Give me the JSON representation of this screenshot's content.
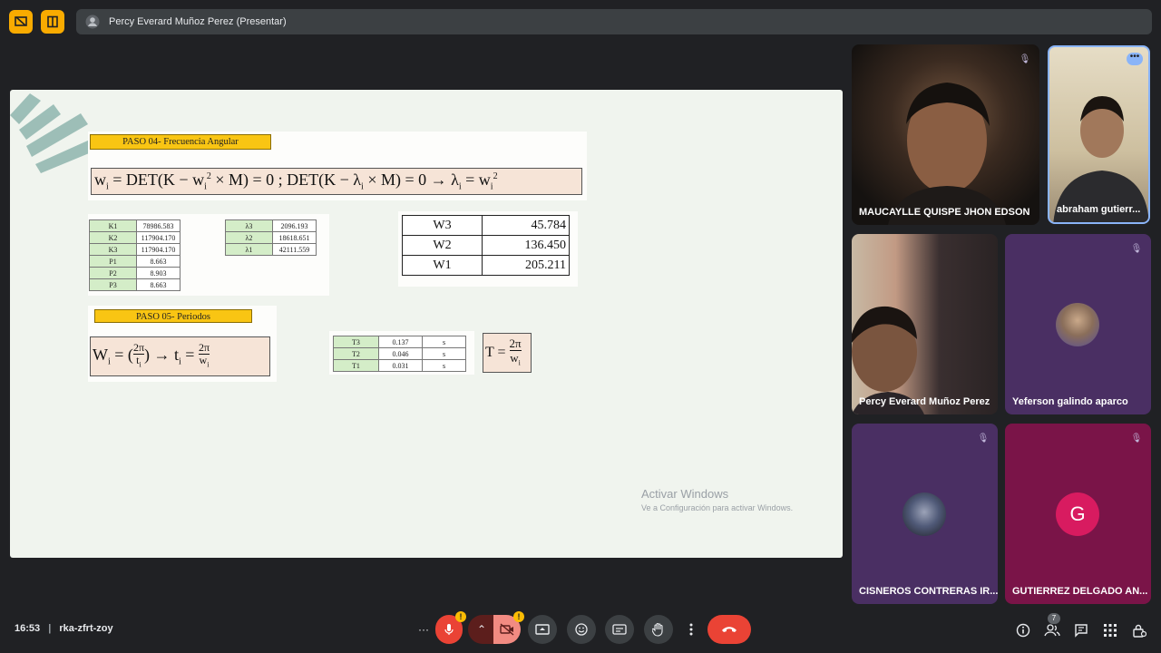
{
  "presenter_banner": "Percy Everard Muñoz Perez (Presentar)",
  "slide": {
    "step4_title": "PASO 04- Frecuencia Angular",
    "step5_title": "PASO 05- Periodos",
    "k_table": [
      {
        "label": "K1",
        "value": "78986.583"
      },
      {
        "label": "K2",
        "value": "117904.170"
      },
      {
        "label": "K3",
        "value": "117904.170"
      },
      {
        "label": "P1",
        "value": "8.663"
      },
      {
        "label": "P2",
        "value": "8.903"
      },
      {
        "label": "P3",
        "value": "8.663"
      }
    ],
    "lambda_table": [
      {
        "label": "λ3",
        "value": "2096.193"
      },
      {
        "label": "λ2",
        "value": "18618.651"
      },
      {
        "label": "λ1",
        "value": "42111.559"
      }
    ],
    "w_table": [
      {
        "label": "W3",
        "value": "45.784"
      },
      {
        "label": "W2",
        "value": "136.450"
      },
      {
        "label": "W1",
        "value": "205.211"
      }
    ],
    "t_table": [
      {
        "label": "T3",
        "value": "0.137",
        "unit": "s"
      },
      {
        "label": "T2",
        "value": "0.046",
        "unit": "s"
      },
      {
        "label": "T1",
        "value": "0.031",
        "unit": "s"
      }
    ],
    "watermark_title": "Activar Windows",
    "watermark_sub": "Ve a Configuración para activar Windows."
  },
  "participants": [
    {
      "name": "MAUCAYLLE QUISPE JHON EDSON"
    },
    {
      "name": "abraham gutierr..."
    },
    {
      "name": "Percy Everard Muñoz Perez"
    },
    {
      "name": "Yeferson galindo aparco"
    },
    {
      "name": "CISNEROS CONTRERAS IR..."
    },
    {
      "name": "GUTIERREZ DELGADO AN...",
      "initial": "G"
    }
  ],
  "meeting": {
    "time": "16:53",
    "separator": "|",
    "code": "rka-zfrt-zoy",
    "participant_count": "7"
  },
  "colors": {
    "bg": "#202124",
    "end_call": "#ea4335",
    "accent_yellow": "#f9ab00",
    "tile_purple": "#4a2f63",
    "tile_magenta": "#7a1448",
    "avatar_g": "#d81b60"
  }
}
